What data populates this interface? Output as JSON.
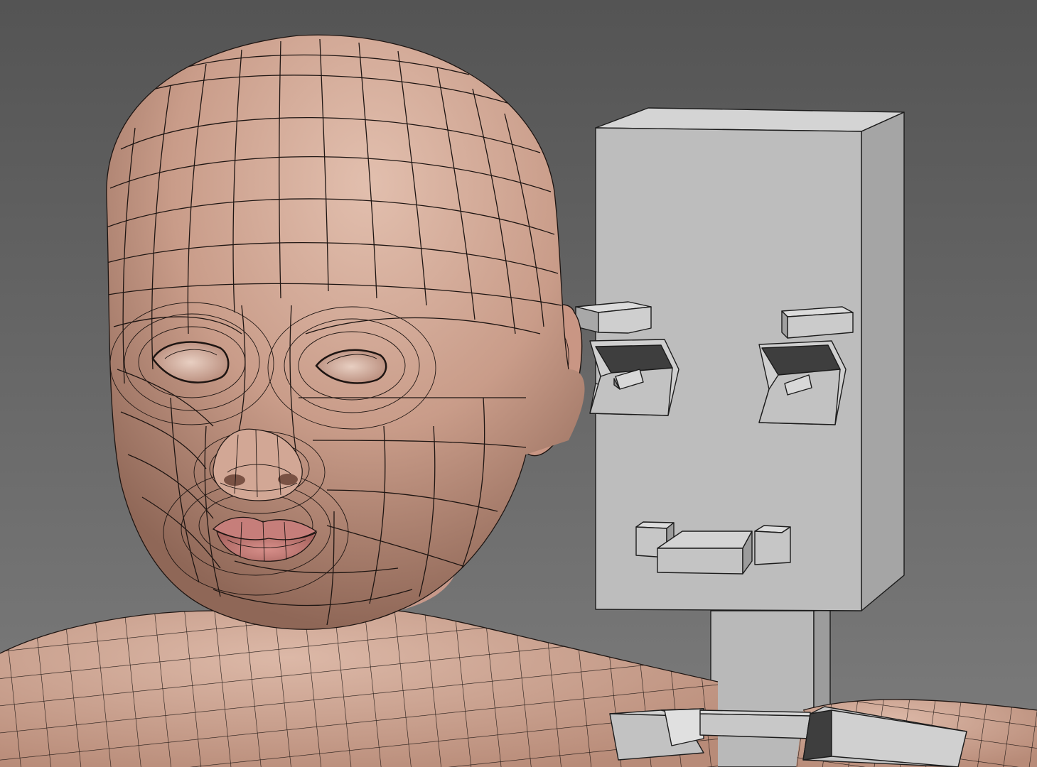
{
  "viewport": {
    "background_top": "#545454",
    "background_bottom": "#7c7c7c",
    "skin_light": "#d9b3a2",
    "skin_mid": "#c49886",
    "skin_dark": "#8f6757",
    "lip_color": "#c97e7b",
    "wire_color": "#1e1512",
    "rig_face": "#b8b8b8",
    "rig_side": "#9a9a9a",
    "rig_top": "#d6d6d6"
  },
  "scene": {
    "objects": [
      {
        "id": "child-head-mesh",
        "icon": "polygon-mesh"
      },
      {
        "id": "face-rig-controls",
        "icon": "box-rig"
      }
    ]
  }
}
